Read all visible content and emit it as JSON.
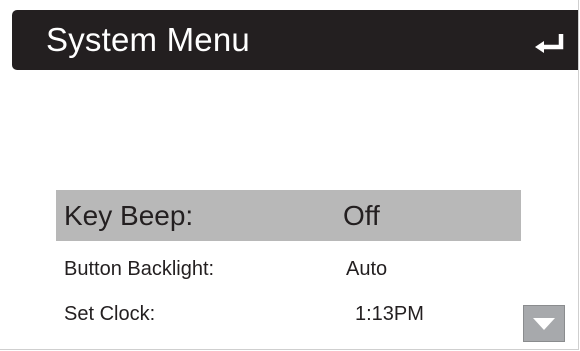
{
  "header": {
    "title": "System Menu",
    "back_icon": "return-arrow-icon"
  },
  "menu": {
    "items": [
      {
        "label": "Key Beep:",
        "value": "Off",
        "selected": true
      },
      {
        "label": "Button Backlight:",
        "value": "Auto",
        "selected": false
      },
      {
        "label": "Set Clock:",
        "value": "1:13PM",
        "selected": false
      }
    ]
  },
  "scroll": {
    "icon": "triangle-down-icon"
  },
  "colors": {
    "header_bg": "#231f20",
    "selected_row_bg": "#b8b8b8",
    "scroll_button_bg": "#a7a9ac"
  }
}
